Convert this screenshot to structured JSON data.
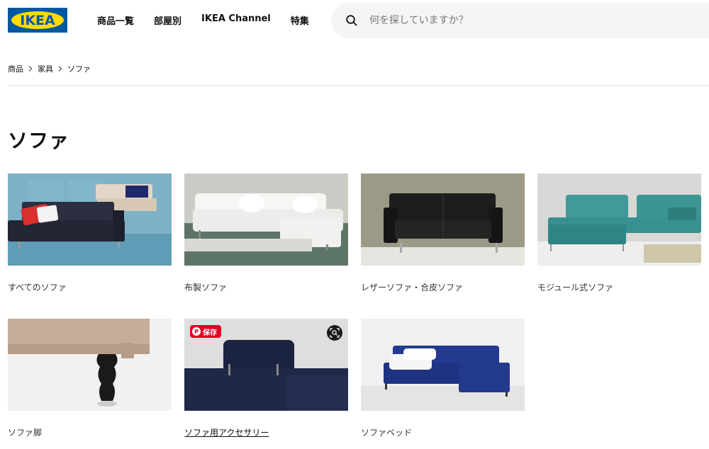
{
  "brand": {
    "logo_text": "IKEA",
    "primary": "#0058a3",
    "accent": "#ffdb00"
  },
  "nav": [
    {
      "label": "商品一覧"
    },
    {
      "label": "部屋別"
    },
    {
      "label": "IKEA Channel"
    },
    {
      "label": "特集"
    }
  ],
  "search": {
    "placeholder": "何を探していますか？",
    "icon": "search-icon"
  },
  "breadcrumb": [
    {
      "label": "商品"
    },
    {
      "label": "家具"
    },
    {
      "label": "ソファ"
    }
  ],
  "page_title": "ソファ",
  "categories": [
    {
      "label": "すべてのソファ"
    },
    {
      "label": "布製ソファ"
    },
    {
      "label": "レザーソファ・合皮ソファ"
    },
    {
      "label": "モジュール式ソファ"
    },
    {
      "label": "ソファ脚"
    },
    {
      "label": "ソファ用アクセサリー",
      "hovered": true
    },
    {
      "label": "ソファベッド"
    }
  ],
  "overlay": {
    "save_label": "保存",
    "save_icon": "pinterest-icon",
    "lens_icon": "visual-search-icon"
  }
}
